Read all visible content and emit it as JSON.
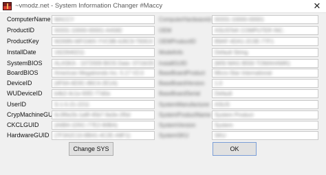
{
  "window": {
    "title": "~vmodz.net - System Information Changer #Maccy",
    "close_glyph": "✕"
  },
  "left_rows": [
    {
      "label": "ComputerName",
      "value": "MACCY"
    },
    {
      "label": "ProductID",
      "value": "00331-10000-00001-AA582"
    },
    {
      "label": "ProductKey",
      "value": "W269N-WFGWX-YVC9B-4J6C9-T83GX"
    },
    {
      "label": "InstallDate",
      "value": "1622640211"
    },
    {
      "label": "SystemBIOS",
      "value": "ALASKA - 1072009 BIOS Date: 07/16/20"
    },
    {
      "label": "BoardBIOS",
      "value": "American Megatrends Inc. 5.17 V2.0"
    },
    {
      "label": "DeviceID",
      "value": "{4F6A-6D3C-86C4-2E1A}"
    },
    {
      "label": "WUDeviceID",
      "value": "b4b2-4c1e-93f2-77d0a"
    },
    {
      "label": "UserID",
      "value": "S-1-5-21-2211"
    },
    {
      "label": "CrypMachineGUID",
      "value": "6c3f6e2b-1a8f-45b7-9a3e-2f0d"
    },
    {
      "label": "CKCLGUID",
      "value": "{A6B4-1D5C-77E2-90BA}"
    },
    {
      "label": "HardwareGUID",
      "value": "{7F3A2C10-BB41-4C2E-A8F1}"
    }
  ],
  "right_rows": [
    {
      "label": "ComputerHardwareId",
      "value": "00331-10000-00001"
    },
    {
      "label": "OEM",
      "value": "ASUSTeK COMPUTER INC."
    },
    {
      "label": "OEMProductID",
      "value": "B9AF-4DA1-2C0E-77F1"
    },
    {
      "label": "ModelInfo",
      "value": "Default String"
    },
    {
      "label": "InstallGUID",
      "value": "{MSI MAG B550 TOMAHAWK}"
    },
    {
      "label": "BaseBoardProduct",
      "value": "Micro-Star International"
    },
    {
      "label": "BaseBoardVersion",
      "value": "1.0"
    },
    {
      "label": "BaseBoardSerial",
      "value": "Default"
    },
    {
      "label": "SystemManufacturer",
      "value": "ASUS"
    },
    {
      "label": "SystemProductName",
      "value": "System Product"
    },
    {
      "label": "SystemVersion",
      "value": "System"
    },
    {
      "label": "SystemSKU",
      "value": "SKU"
    }
  ],
  "buttons": {
    "change": "Change SYS",
    "ok": "OK"
  },
  "colors": {
    "app_icon_top": "#7a1f1f",
    "app_icon_bottom": "#d43a2f"
  }
}
